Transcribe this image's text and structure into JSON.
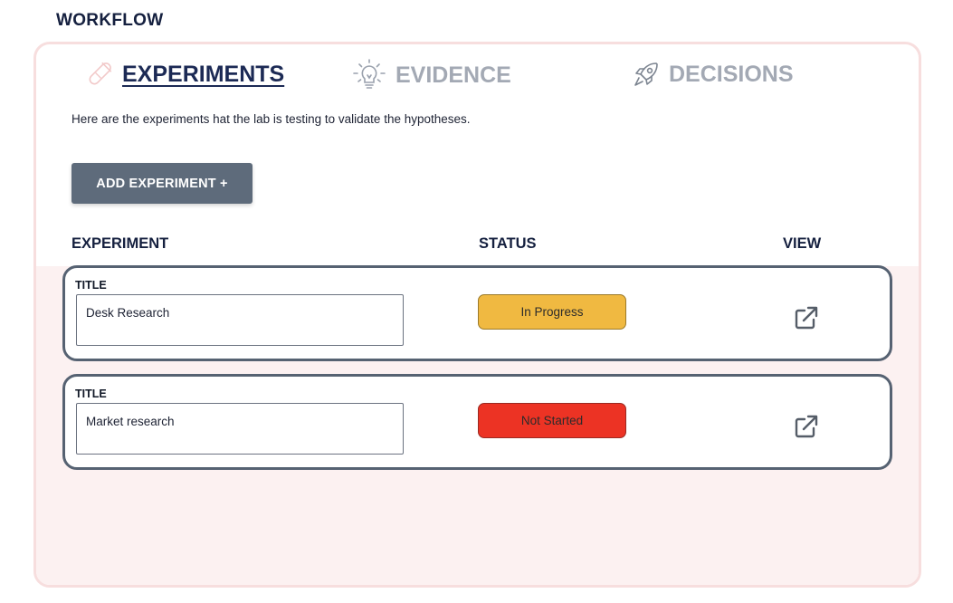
{
  "page": {
    "heading": "WORKFLOW"
  },
  "tabs": [
    {
      "label": "EXPERIMENTS",
      "icon": "test-tube-icon",
      "active": true
    },
    {
      "label": "EVIDENCE",
      "icon": "lightbulb-icon",
      "active": false
    },
    {
      "label": "DECISIONS",
      "icon": "rocket-icon",
      "active": false
    }
  ],
  "experiments_panel": {
    "description": "Here are the experiments hat the lab is testing to validate the hypotheses.",
    "add_button_label": "ADD EXPERIMENT +",
    "columns": {
      "experiment": "EXPERIMENT",
      "status": "STATUS",
      "view": "VIEW"
    },
    "rows": [
      {
        "title_label": "TITLE",
        "title_value": "Desk Research",
        "status": "In Progress",
        "status_color": "#f0b941"
      },
      {
        "title_label": "TITLE",
        "title_value": "Market research",
        "status": "Not Started",
        "status_color": "#ec3324"
      }
    ]
  },
  "colors": {
    "panel_border": "#f7dede",
    "panel_lower_bg": "#fcf1f1",
    "row_border": "#566272",
    "button_bg": "#5e6b7b",
    "active_tab": "#1c2a55",
    "inactive_tab": "#a3a9b4"
  }
}
